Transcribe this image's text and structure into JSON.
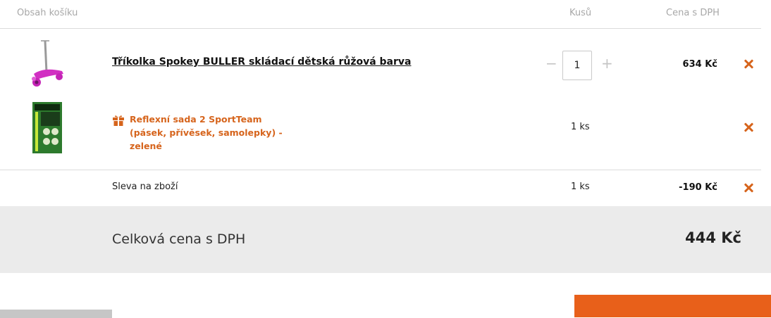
{
  "header": {
    "content_label": "Obsah košíku",
    "qty_label": "Kusů",
    "price_label": "Cena s DPH"
  },
  "items": [
    {
      "name": "Tříkolka Spokey BULLER skládací dětská růžová barva",
      "image_icon": "pink-scooter-image",
      "quantity": "1",
      "minus_label": "−",
      "plus_label": "+",
      "price": "634 Kč"
    }
  ],
  "gift": {
    "icon": "gift-icon",
    "name": "Reflexní sada 2 SportTeam (pásek, přívěsek, samolepky) - zelené",
    "image_icon": "reflective-set-image",
    "quantity": "1 ks"
  },
  "discount": {
    "label": "Sleva na zboží",
    "quantity": "1 ks",
    "price": "-190 Kč"
  },
  "total": {
    "label": "Celková cena s DPH",
    "value": "444 Kč"
  },
  "colors": {
    "accent": "#e8601a",
    "remove": "#d6641c",
    "total_bg": "#ebebeb"
  }
}
